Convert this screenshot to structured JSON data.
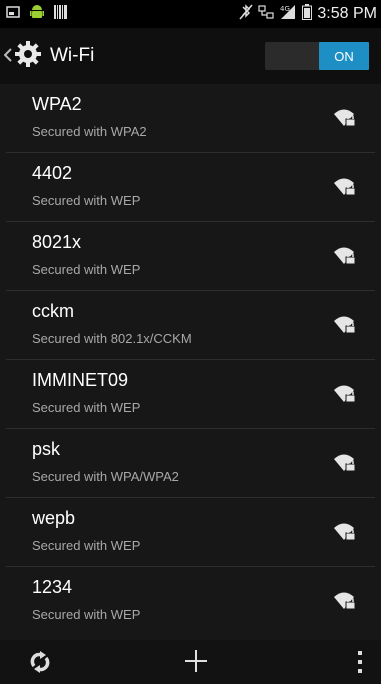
{
  "status_bar": {
    "time": "3:58 PM"
  },
  "action_bar": {
    "title": "Wi-Fi",
    "toggle_label": "ON"
  },
  "networks": [
    {
      "ssid": "WPA2",
      "security": "Secured with WPA2"
    },
    {
      "ssid": "4402",
      "security": "Secured with WEP"
    },
    {
      "ssid": "8021x",
      "security": "Secured with WEP"
    },
    {
      "ssid": "cckm",
      "security": "Secured with 802.1x/CCKM"
    },
    {
      "ssid": "IMMINET09",
      "security": "Secured with WEP"
    },
    {
      "ssid": "psk",
      "security": "Secured with WPA/WPA2"
    },
    {
      "ssid": "wepb",
      "security": "Secured with WEP"
    },
    {
      "ssid": "1234",
      "security": "Secured with WEP"
    }
  ],
  "icons": {
    "status_left": [
      "screenshot-icon",
      "android-icon",
      "barcode-icon"
    ],
    "status_right": [
      "bluetooth-off-icon",
      "network-icon",
      "signal-4g-icon",
      "battery-icon"
    ],
    "action_bar": [
      "back-chevron-icon",
      "settings-gear-icon"
    ],
    "network_row": "wifi-locked-icon",
    "bottom_bar": [
      "refresh-icon",
      "add-icon",
      "overflow-menu-icon"
    ]
  },
  "colors": {
    "accent": "#1e8fc4",
    "list_bg": "#171717",
    "secondary_text": "#a8a8a8"
  }
}
